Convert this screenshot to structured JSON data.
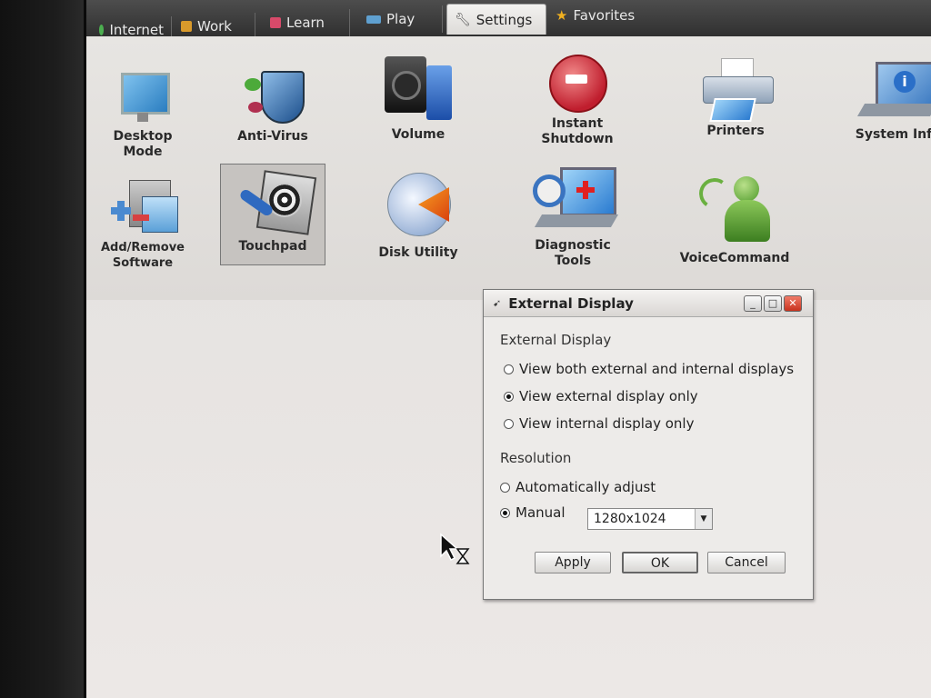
{
  "tabs": [
    {
      "label": "Internet",
      "icon": "globe-icon",
      "color": "#4caf50"
    },
    {
      "label": "Work",
      "icon": "briefcase-icon",
      "color": "#d99a2b"
    },
    {
      "label": "Learn",
      "icon": "book-icon",
      "color": "#d84a6a"
    },
    {
      "label": "Play",
      "icon": "gamepad-icon",
      "color": "#5fa0d0"
    },
    {
      "label": "Settings",
      "icon": "wrench-icon",
      "color": "#666666"
    },
    {
      "label": "Favorites",
      "icon": "star-icon",
      "color": "#f0b020"
    }
  ],
  "apps": [
    {
      "label": "Desktop Mode",
      "icon": "monitor-icon"
    },
    {
      "label": "Anti-Virus",
      "icon": "shield-icon"
    },
    {
      "label": "Volume",
      "icon": "speaker-icon"
    },
    {
      "label": "Instant",
      "label2": "Shutdown",
      "icon": "shutdown-icon"
    },
    {
      "label": "Printers",
      "icon": "printer-icon"
    },
    {
      "label": "System Inf",
      "icon": "info-laptop-icon"
    },
    {
      "label": "Add/Remove",
      "label2": "Software",
      "icon": "add-remove-icon"
    },
    {
      "label": "Touchpad",
      "icon": "touchpad-icon"
    },
    {
      "label": "Disk Utility",
      "icon": "disk-icon"
    },
    {
      "label": "Diagnostic",
      "label2": "Tools",
      "icon": "diagnostic-icon"
    },
    {
      "label": "VoiceCommand",
      "icon": "voice-icon"
    }
  ],
  "dialog": {
    "title": "External Display",
    "section_display": "External Display",
    "options_display": [
      {
        "label": "View both external and internal displays",
        "selected": false
      },
      {
        "label": "View external display only",
        "selected": true
      },
      {
        "label": "View internal display only",
        "selected": false
      }
    ],
    "section_resolution": "Resolution",
    "opt_auto": "Automatically adjust",
    "opt_manual": "Manual",
    "manual_selected": true,
    "resolution_value": "1280x1024",
    "apply": "Apply",
    "ok": "OK",
    "cancel": "Cancel"
  }
}
